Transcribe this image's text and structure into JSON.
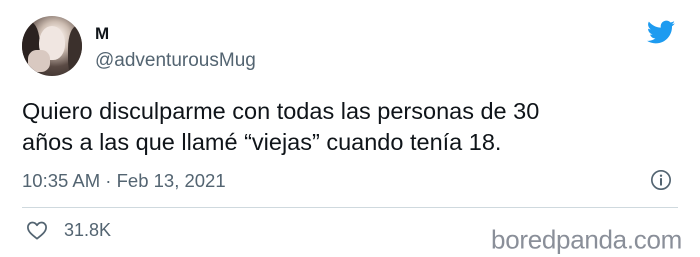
{
  "author": {
    "name": "M",
    "handle": "@adventurousMug"
  },
  "tweet": {
    "text": "Quiero disculparme con todas las personas de 30\naños a las que llamé “viejas” cuando tenía 18.",
    "timestamp": "10:35 AM · Feb 13, 2021"
  },
  "engagement": {
    "likes": "31.8K"
  },
  "icons": {
    "brand": "twitter-bird-icon",
    "info": "info-icon",
    "like": "heart-icon"
  },
  "colors": {
    "twitter_blue": "#1d9bf0",
    "secondary_text": "#536471",
    "divider": "#cfd9de"
  },
  "watermark": "boredpanda.com"
}
